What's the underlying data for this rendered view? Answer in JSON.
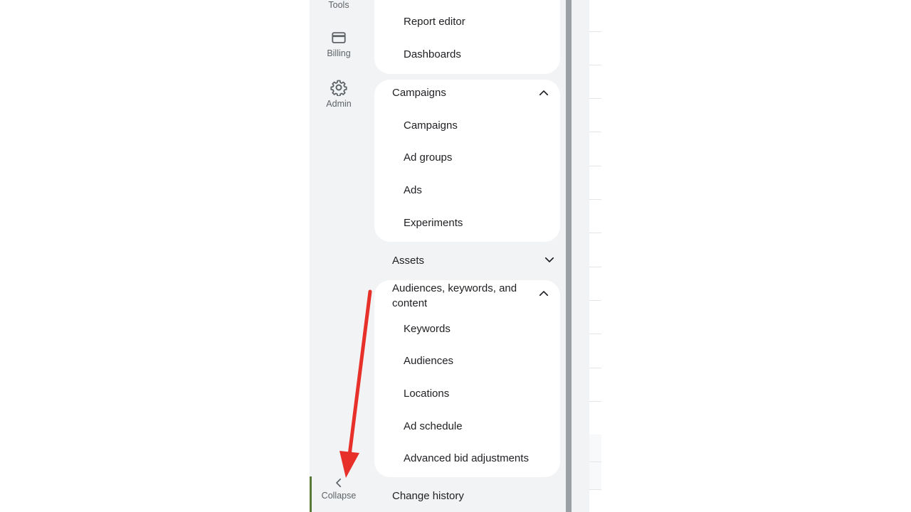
{
  "rail": {
    "tools_label": "Tools",
    "billing_label": "Billing",
    "admin_label": "Admin",
    "collapse_label": "Collapse"
  },
  "nav": {
    "reports_items": [
      "Report editor",
      "Dashboards"
    ],
    "campaigns": {
      "header": "Campaigns",
      "items": [
        "Campaigns",
        "Ad groups",
        "Ads",
        "Experiments"
      ]
    },
    "assets": {
      "header": "Assets"
    },
    "audiences": {
      "header_line1": "Audiences, keywords, and",
      "header_line2": "content",
      "items": [
        "Keywords",
        "Audiences",
        "Locations",
        "Ad schedule",
        "Advanced bid adjustments"
      ]
    },
    "change_history": "Change history"
  },
  "icons": {
    "billing": "credit-card-icon",
    "admin": "gear-icon",
    "collapse": "chevron-left-icon",
    "expanded": "chevron-up-icon",
    "collapsed": "chevron-down-icon"
  },
  "colors": {
    "panel_bg": "#f1f3f4",
    "card_bg": "#ffffff",
    "text": "#202124",
    "muted": "#5f6368",
    "annotation_arrow": "#e8302a"
  }
}
